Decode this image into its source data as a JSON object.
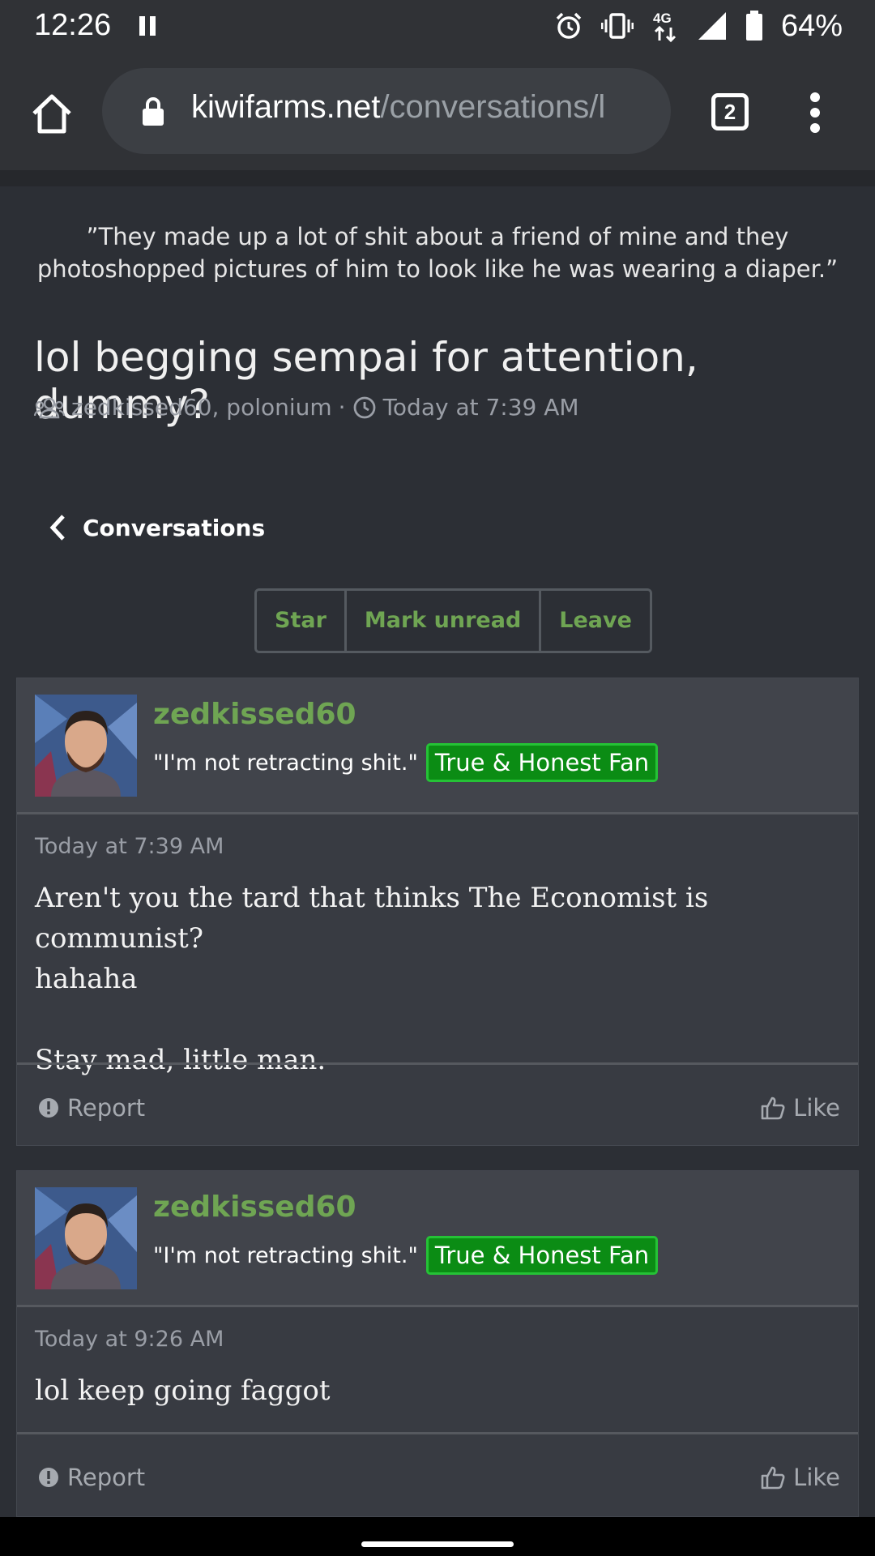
{
  "status_bar": {
    "time": "12:26",
    "network": "4G",
    "battery": "64%"
  },
  "browser": {
    "url_host": "kiwifarms.net",
    "url_path": "/conversations/l",
    "tab_count": "2"
  },
  "page": {
    "quote": "”They made up a lot of shit about a friend of mine and they photoshopped pictures of him to look like he was wearing a diaper.”",
    "title": "lol begging sempai for attention, dummy?",
    "participants": "zedkissed60, polonium",
    "separator": "·",
    "started": "Today at 7:39 AM",
    "back_label": "Conversations",
    "actions": {
      "star": "Star",
      "mark_unread": "Mark unread",
      "leave": "Leave"
    }
  },
  "messages": [
    {
      "username": "zedkissed60",
      "user_title": "\"I'm not retracting shit.\"",
      "badge": "True & Honest Fan",
      "time": "Today at 7:39 AM",
      "lines": [
        "Aren't you the tard that thinks The Economist is communist?",
        "hahaha",
        "",
        "Stay mad, little man."
      ],
      "report": "Report",
      "like": "Like"
    },
    {
      "username": "zedkissed60",
      "user_title": "\"I'm not retracting shit.\"",
      "badge": "True & Honest Fan",
      "time": "Today at 9:26 AM",
      "lines": [
        "lol keep going faggot"
      ],
      "report": "Report",
      "like": "Like"
    }
  ],
  "colors": {
    "accent_green": "#6fa553",
    "badge_green": "#0b8c14",
    "background": "#2c2f35"
  }
}
